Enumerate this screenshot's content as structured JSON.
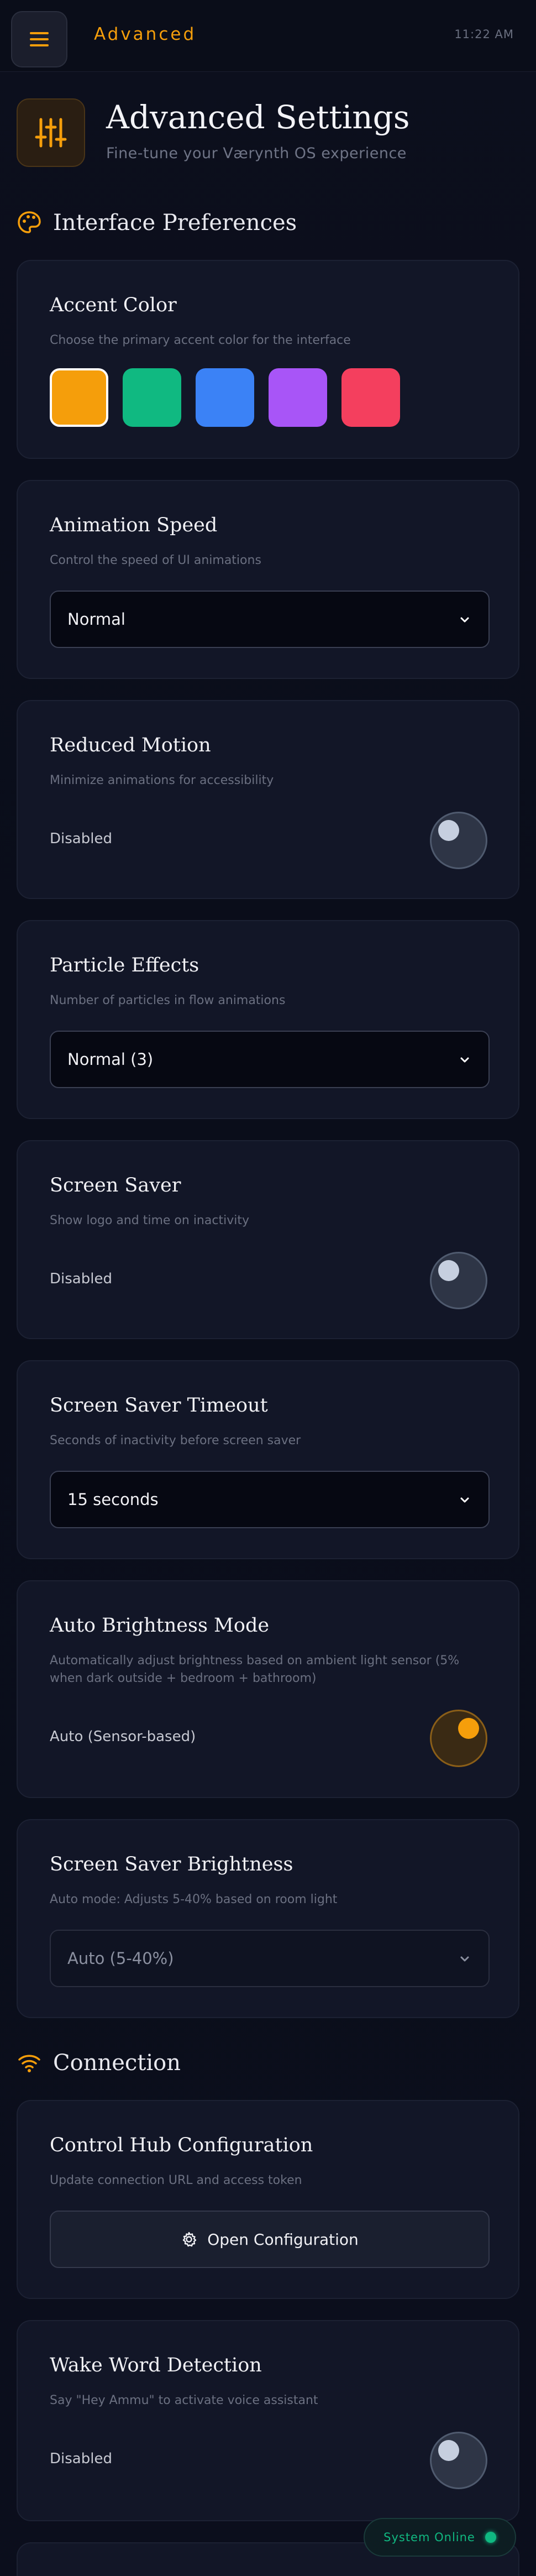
{
  "topbar": {
    "app_title": "Advanced",
    "clock": "11:22 AM"
  },
  "header": {
    "title": "Advanced Settings",
    "subtitle": "Fine-tune your Værynth OS experience"
  },
  "colors": {
    "accent": "#f59e0b",
    "status_online": "#10b981"
  },
  "sections": {
    "interface": {
      "label": "Interface Preferences",
      "icon": "palette-icon"
    },
    "connection": {
      "label": "Connection",
      "icon": "wifi-icon"
    }
  },
  "accent_color": {
    "title": "Accent Color",
    "desc": "Choose the primary accent color for the interface",
    "swatches": [
      "#f59e0b",
      "#10b981",
      "#3b82f6",
      "#a855f7",
      "#f43f5e"
    ],
    "selected_index": 0
  },
  "animation_speed": {
    "title": "Animation Speed",
    "desc": "Control the speed of UI animations",
    "value": "Normal"
  },
  "reduced_motion": {
    "title": "Reduced Motion",
    "desc": "Minimize animations for accessibility",
    "state": "Disabled",
    "on": false
  },
  "particle_effects": {
    "title": "Particle Effects",
    "desc": "Number of particles in flow animations",
    "value": "Normal (3)"
  },
  "screen_saver": {
    "title": "Screen Saver",
    "desc": "Show logo and time on inactivity",
    "state": "Disabled",
    "on": false
  },
  "screen_saver_timeout": {
    "title": "Screen Saver Timeout",
    "desc": "Seconds of inactivity before screen saver",
    "value": "15 seconds"
  },
  "auto_brightness": {
    "title": "Auto Brightness Mode",
    "desc": "Automatically adjust brightness based on ambient light sensor (5% when dark outside + bedroom + bathroom)",
    "state": "Auto (Sensor-based)",
    "on": true
  },
  "screen_saver_brightness": {
    "title": "Screen Saver Brightness",
    "desc": "Auto mode: Adjusts 5-40% based on room light",
    "value": "Auto (5-40%)"
  },
  "control_hub": {
    "title": "Control Hub Configuration",
    "desc": "Update connection URL and access token",
    "button_label": "Open Configuration"
  },
  "wake_word": {
    "title": "Wake Word Detection",
    "desc": "Say \"Hey Ammu\" to activate voice assistant",
    "state": "Disabled",
    "on": false
  },
  "status": {
    "label": "System Online"
  }
}
